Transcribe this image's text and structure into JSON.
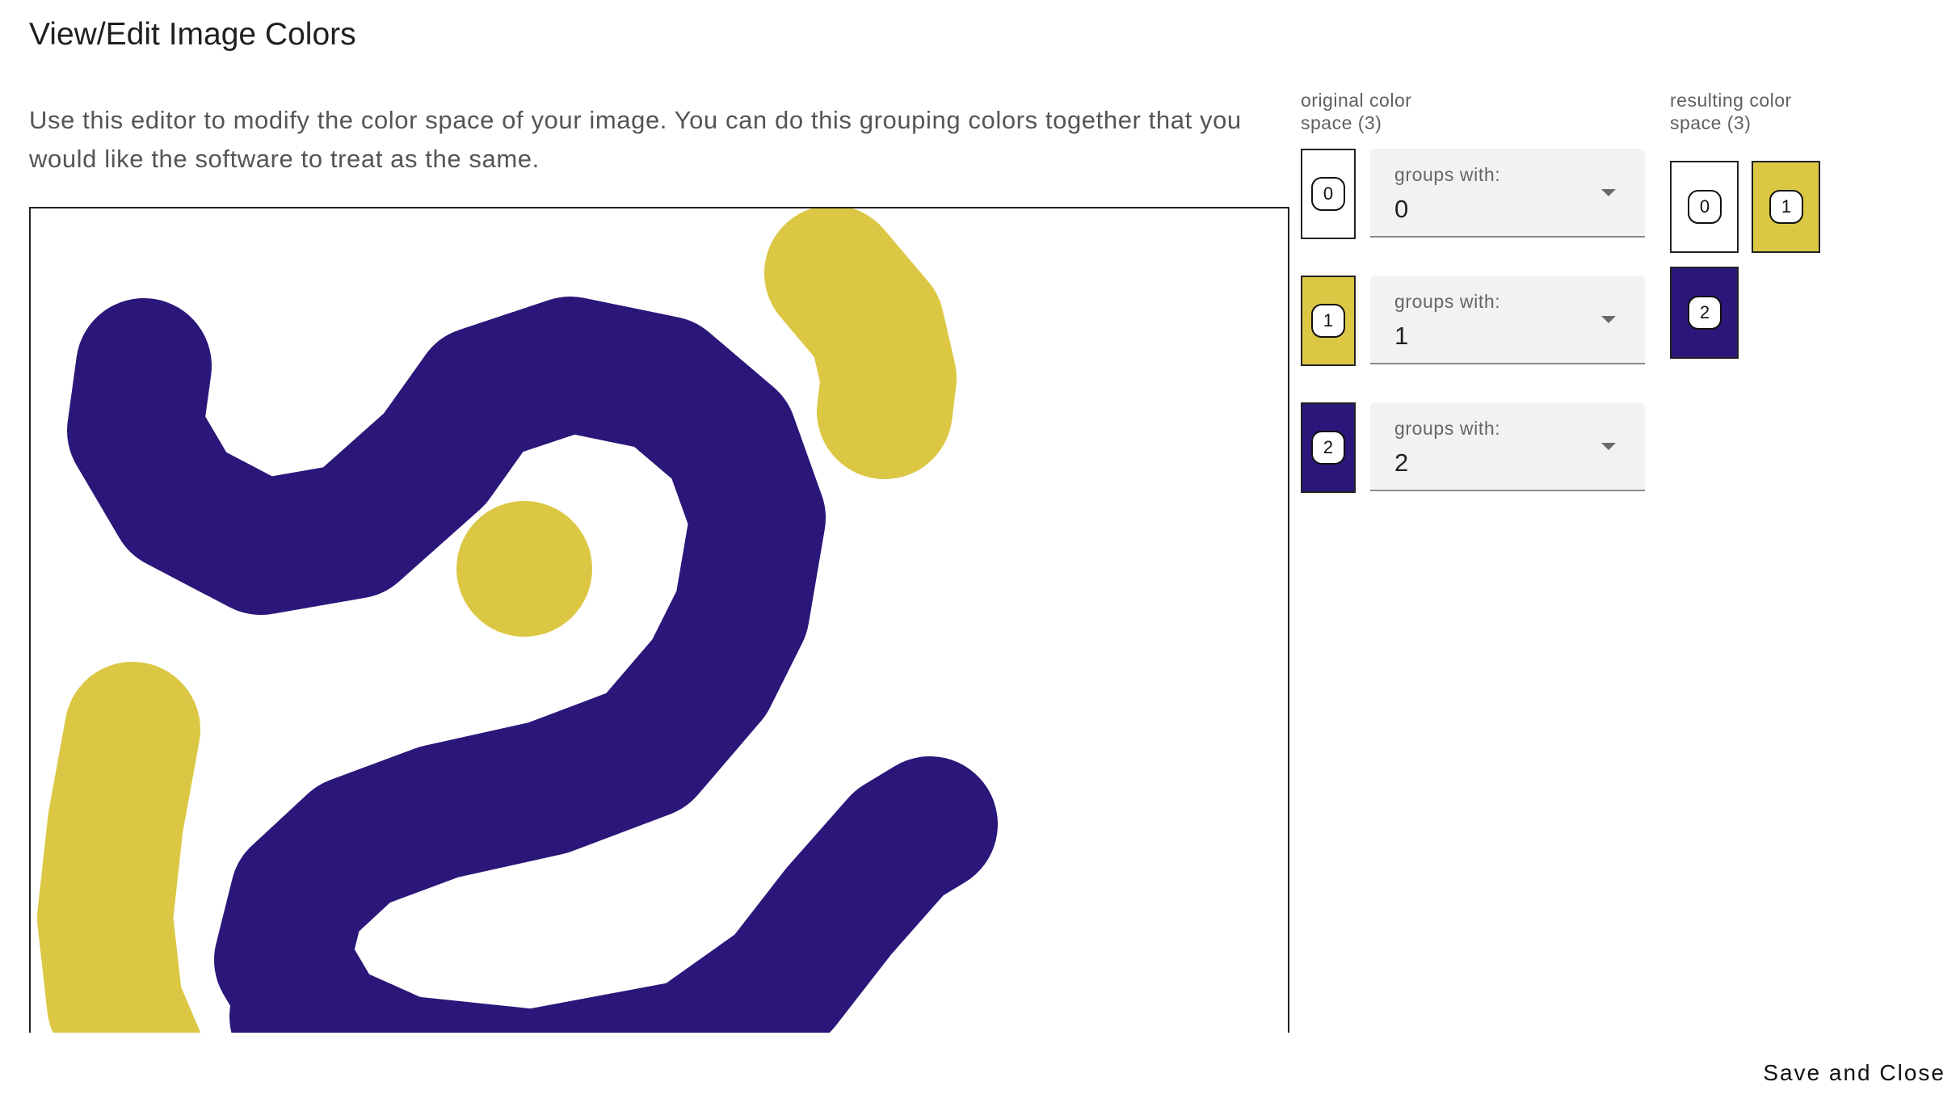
{
  "dialog": {
    "title": "View/Edit Image Colors",
    "description": "Use this editor to modify the color space of your image. You can do this grouping colors together that you would like the software to treat as the same."
  },
  "colors": {
    "white": "#ffffff",
    "yellow": "#dbc744",
    "navy": "#2b1779"
  },
  "original": {
    "heading": "original color space (3)",
    "swatches": [
      {
        "index": "0",
        "color": "#ffffff",
        "select_label": "groups with:",
        "select_value": "0"
      },
      {
        "index": "1",
        "color": "#dbc744",
        "select_label": "groups with:",
        "select_value": "1"
      },
      {
        "index": "2",
        "color": "#2b1779",
        "select_label": "groups with:",
        "select_value": "2"
      }
    ]
  },
  "resulting": {
    "heading": "resulting color space (3)",
    "swatches": [
      {
        "index": "0",
        "color": "#ffffff"
      },
      {
        "index": "1",
        "color": "#dbc744"
      },
      {
        "index": "2",
        "color": "#2b1779"
      }
    ]
  },
  "footer": {
    "save_label": "Save and Close"
  }
}
